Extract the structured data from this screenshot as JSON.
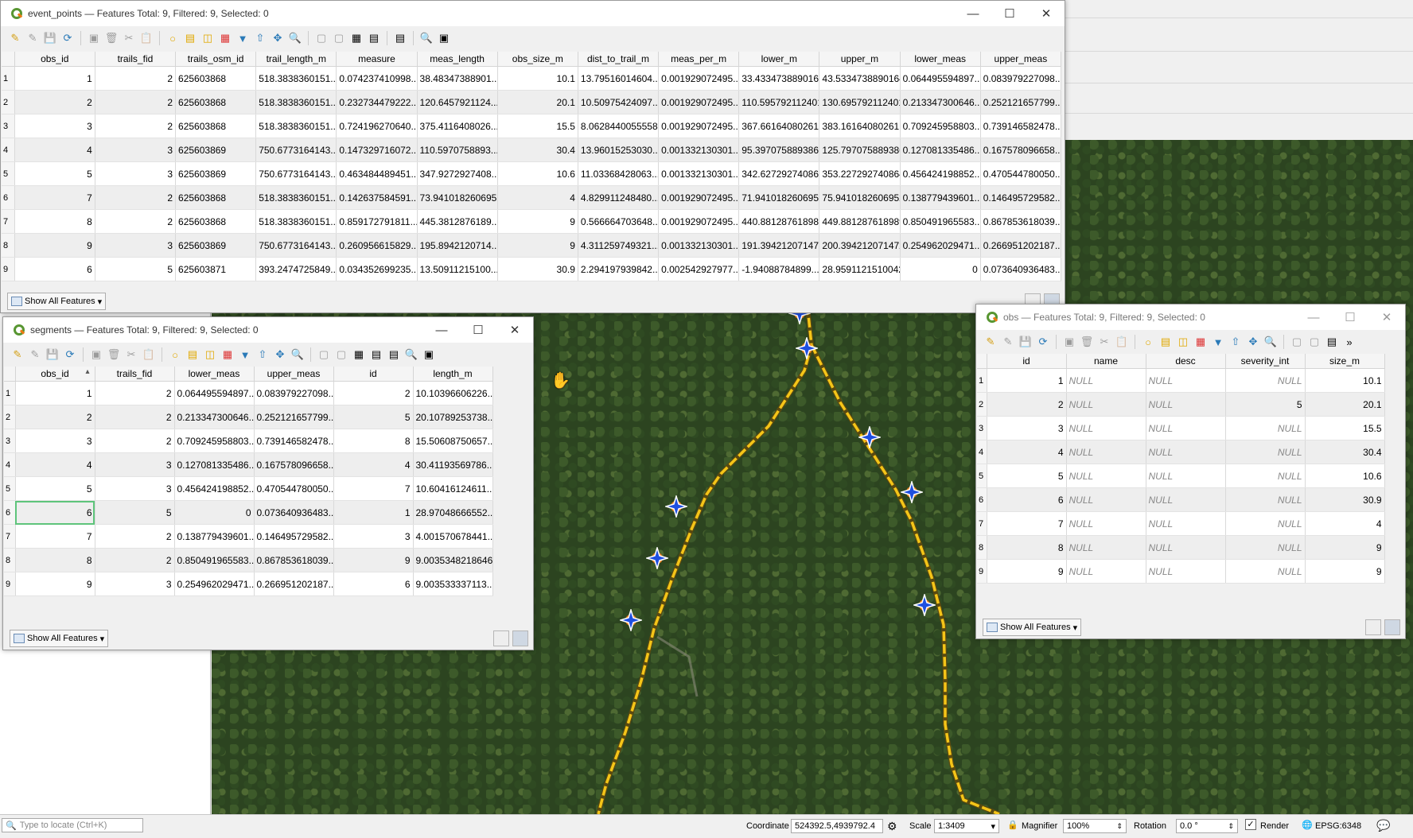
{
  "event_points": {
    "title": "event_points — Features Total: 9, Filtered: 9, Selected: 0",
    "columns": [
      "obs_id",
      "trails_fid",
      "trails_osm_id",
      "trail_length_m",
      "measure",
      "meas_length",
      "obs_size_m",
      "dist_to_trail_m",
      "meas_per_m",
      "lower_m",
      "upper_m",
      "lower_meas",
      "upper_meas"
    ],
    "rows": [
      [
        "1",
        "1",
        "2",
        "625603868",
        "518.3838360151...",
        "0.074237410998...",
        "38.48347388901...",
        "10.1",
        "13.79516014604...",
        "0.001929072495...",
        "33.4334738890164",
        "43.5334738890164",
        "0.064495594897...",
        "0.083979227098..."
      ],
      [
        "2",
        "2",
        "2",
        "625603868",
        "518.3838360151...",
        "0.232734479222...",
        "120.6457921124...",
        "20.1",
        "10.50975424097...",
        "0.001929072495...",
        "110.595792112401",
        "130.695792112401",
        "0.213347300646...",
        "0.252121657799..."
      ],
      [
        "3",
        "3",
        "2",
        "625603868",
        "518.3838360151...",
        "0.724196270640...",
        "375.4116408026...",
        "15.5",
        "8.06284400555588",
        "0.001929072495...",
        "367.66164080261",
        "383.16164080261",
        "0.709245958803...",
        "0.739146582478..."
      ],
      [
        "4",
        "4",
        "3",
        "625603869",
        "750.6773164143...",
        "0.147329716072...",
        "110.5970758893...",
        "30.4",
        "13.96015253030...",
        "0.001332130301...",
        "95.3970758893862",
        "125.797075889386",
        "0.127081335486...",
        "0.167578096658..."
      ],
      [
        "5",
        "5",
        "3",
        "625603869",
        "750.6773164143...",
        "0.463484489451...",
        "347.9272927408...",
        "10.6",
        "11.03368428063...",
        "0.001332130301...",
        "342.627292740864",
        "353.227292740864",
        "0.456424198852...",
        "0.470544780050..."
      ],
      [
        "6",
        "7",
        "2",
        "625603868",
        "518.3838360151...",
        "0.142637584591...",
        "73.9410182606952",
        "4",
        "4.829911248480...",
        "0.001929072495...",
        "71.9410182606952",
        "75.9410182606952",
        "0.138779439601...",
        "0.146495729582..."
      ],
      [
        "7",
        "8",
        "2",
        "625603868",
        "518.3838360151...",
        "0.859172791811...",
        "445.3812876189...",
        "9",
        "0.566664703648...",
        "0.001929072495...",
        "440.881287618989",
        "449.881287618989",
        "0.850491965583...",
        "0.867853618039..."
      ],
      [
        "8",
        "9",
        "3",
        "625603869",
        "750.6773164143...",
        "0.260956615829...",
        "195.8942120714...",
        "9",
        "4.311259749321...",
        "0.001332130301...",
        "191.394212071472",
        "200.394212071472",
        "0.254962029471...",
        "0.266951202187..."
      ],
      [
        "9",
        "6",
        "5",
        "625603871",
        "393.2474725849...",
        "0.034352699235...",
        "13.50911215100...",
        "30.9",
        "2.294197939842...",
        "0.002542927977...",
        "-1.94088784899...",
        "28.9591121510042",
        "0",
        "0.073640936483..."
      ]
    ],
    "footer_label": "Show All Features"
  },
  "segments": {
    "title": "segments — Features Total: 9, Filtered: 9, Selected: 0",
    "columns": [
      "obs_id",
      "trails_fid",
      "lower_meas",
      "upper_meas",
      "id",
      "length_m"
    ],
    "rows": [
      [
        "1",
        "1",
        "2",
        "0.064495594897...",
        "0.083979227098...",
        "2",
        "10.10396606226..."
      ],
      [
        "2",
        "2",
        "2",
        "0.213347300646...",
        "0.252121657799...",
        "5",
        "20.10789253738..."
      ],
      [
        "3",
        "3",
        "2",
        "0.709245958803...",
        "0.739146582478...",
        "8",
        "15.50608750657..."
      ],
      [
        "4",
        "4",
        "3",
        "0.127081335486...",
        "0.167578096658...",
        "4",
        "30.41193569786..."
      ],
      [
        "5",
        "5",
        "3",
        "0.456424198852...",
        "0.470544780050...",
        "7",
        "10.60416124611..."
      ],
      [
        "6",
        "6",
        "5",
        "0",
        "0.073640936483...",
        "1",
        "28.97048666552..."
      ],
      [
        "7",
        "7",
        "2",
        "0.138779439601...",
        "0.146495729582...",
        "3",
        "4.001570678441..."
      ],
      [
        "8",
        "8",
        "2",
        "0.850491965583...",
        "0.867853618039...",
        "9",
        "9.0035348218646"
      ],
      [
        "9",
        "9",
        "3",
        "0.254962029471...",
        "0.266951202187...",
        "6",
        "9.003533337113..."
      ]
    ],
    "footer_label": "Show All Features"
  },
  "obs": {
    "title": "obs — Features Total: 9, Filtered: 9, Selected: 0",
    "columns": [
      "id",
      "name",
      "desc",
      "severity_int",
      "size_m"
    ],
    "rows": [
      [
        "1",
        "1",
        "NULL",
        "NULL",
        "NULL",
        "10.1"
      ],
      [
        "2",
        "2",
        "NULL",
        "NULL",
        "5",
        "20.1"
      ],
      [
        "3",
        "3",
        "NULL",
        "NULL",
        "NULL",
        "15.5"
      ],
      [
        "4",
        "4",
        "NULL",
        "NULL",
        "NULL",
        "30.4"
      ],
      [
        "5",
        "5",
        "NULL",
        "NULL",
        "NULL",
        "10.6"
      ],
      [
        "6",
        "6",
        "NULL",
        "NULL",
        "NULL",
        "30.9"
      ],
      [
        "7",
        "7",
        "NULL",
        "NULL",
        "NULL",
        "4"
      ],
      [
        "8",
        "8",
        "NULL",
        "NULL",
        "NULL",
        "9"
      ],
      [
        "9",
        "9",
        "NULL",
        "NULL",
        "NULL",
        "9"
      ]
    ],
    "footer_label": "Show All Features"
  },
  "left_panel": {
    "locate_placeholder": "Type to locate (Ctrl+K)"
  },
  "statusbar": {
    "coordinate_label": "Coordinate",
    "coordinate_value": "524392.5,4939792.4",
    "scale_label": "Scale",
    "scale_value": "1:3409",
    "magnifier_label": "Magnifier",
    "magnifier_value": "100%",
    "rotation_label": "Rotation",
    "rotation_value": "0.0 °",
    "render_label": "Render",
    "crs_label": "EPSG:6348"
  },
  "colors": {
    "trail": "#f5c518",
    "marker_fill": "#1f4fe0",
    "marker_outline": "#ffffff",
    "marker_under": "#f07f1a",
    "qgis_green": "#589632"
  }
}
